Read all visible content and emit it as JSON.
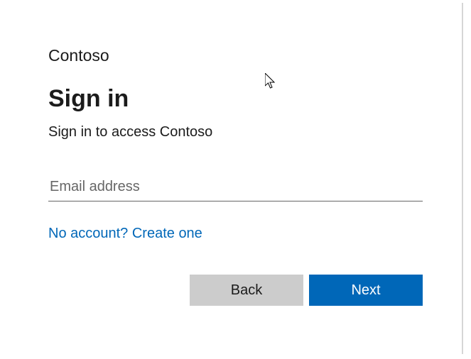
{
  "brand": "Contoso",
  "title": "Sign in",
  "subtitle": "Sign in to access Contoso",
  "email": {
    "placeholder": "Email address",
    "value": ""
  },
  "createAccountLink": "No account? Create one",
  "buttons": {
    "back": "Back",
    "next": "Next"
  }
}
